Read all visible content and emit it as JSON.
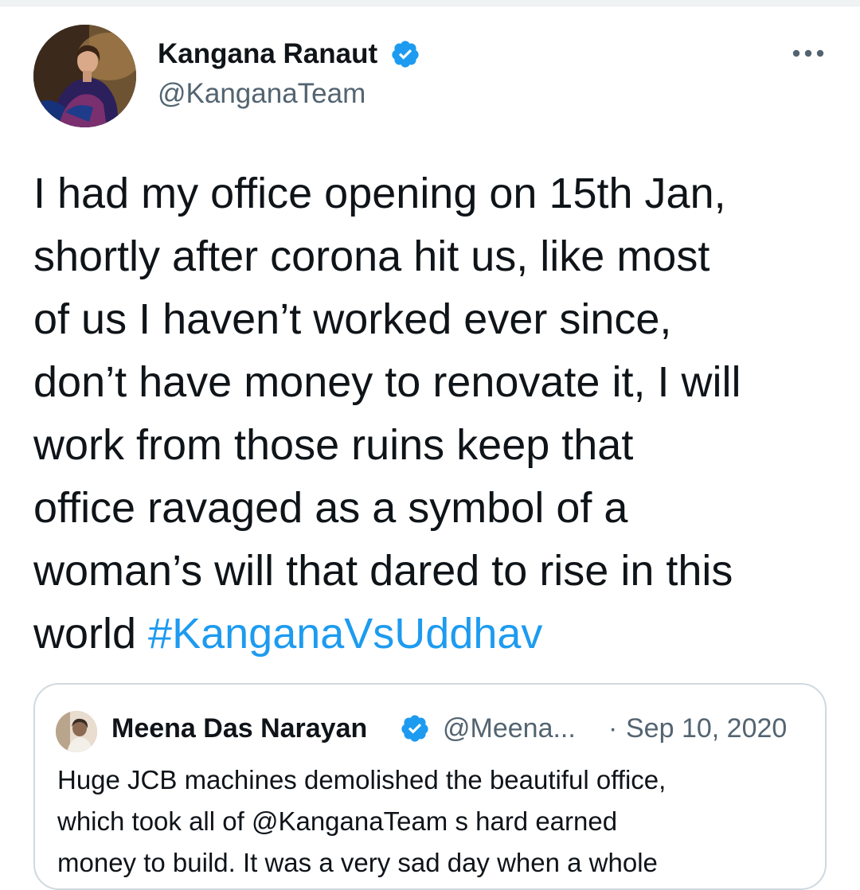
{
  "tweet": {
    "author": {
      "name": "Kangana Ranaut",
      "handle": "@KanganaTeam",
      "verified_icon": "verified-badge-icon"
    },
    "more_icon": "more-options-icon",
    "lines": [
      "I had my office opening on 15th Jan,",
      "shortly after corona hit us, like most",
      "of us I haven’t worked ever since,",
      "don’t have money to renovate it, I will",
      "work from those ruins keep that",
      "office ravaged as a symbol of a",
      "woman’s will that dared to rise in this"
    ],
    "last_line_text": "world ",
    "hashtag": "#KanganaVsUddhav"
  },
  "quote": {
    "author": {
      "name": "Meena Das Narayan",
      "handle": "@Meena...",
      "verified_icon": "verified-badge-icon"
    },
    "separator": "·",
    "date": "Sep 10, 2020",
    "lines": [
      "Huge JCB machines demolished the beautiful office,",
      "which took all of @KanganaTeam s hard earned",
      "money to build. It was  a very sad day when a whole"
    ]
  },
  "colors": {
    "text": "#0f1419",
    "secondary_text": "#536471",
    "link": "#1d9bf0",
    "verified": "#1d9bf0",
    "border": "#cfd9de"
  }
}
